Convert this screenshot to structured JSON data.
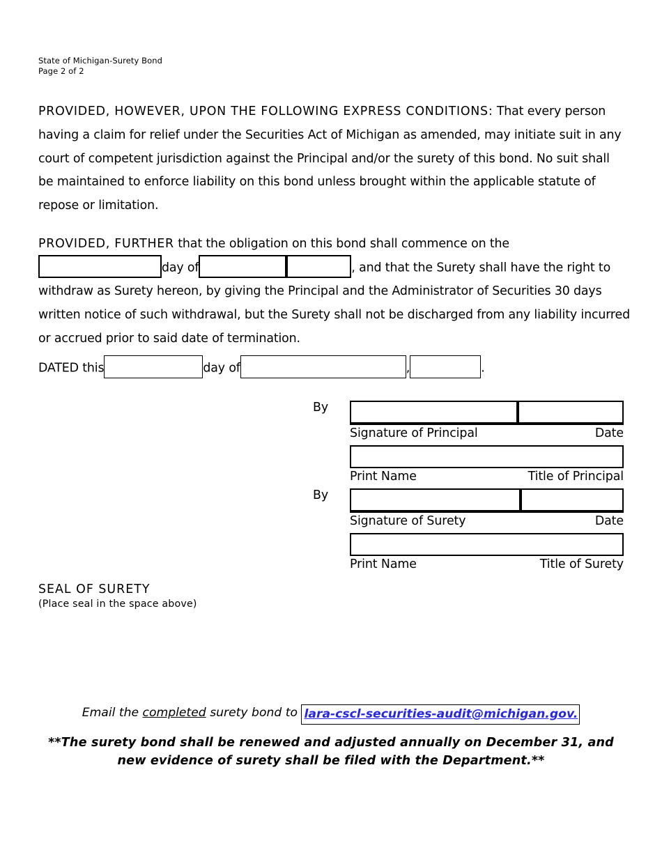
{
  "header": {
    "line1": "State of Michigan-Surety Bond",
    "line2": "Page 2 of 2"
  },
  "paragraph1": {
    "lead": "PROVIDED, HOWEVER, UPON THE FOLLOWING EXPRESS CONDITIONS:",
    "body": " That every person having a claim for relief under the Securities Act of Michigan as amended, may initiate suit in any court of competent jurisdiction against the Principal and/or the surety of this bond. No suit shall be maintained to enforce liability on this bond unless brought within the applicable statute of repose or limitation."
  },
  "paragraph2": {
    "lead": "PROVIDED, FURTHER",
    "line1_after_lead": " that the obligation on this bond shall commence on the",
    "mid_day_of": "day of",
    "after_year": ", and that the Surety shall have the right to",
    "rest": "withdraw as Surety hereon, by giving the Principal and the Administrator of Securities 30 days written notice of such withdrawal, but the Surety shall not be discharged from any liability incurred or accrued prior to said date of termination.",
    "fields": {
      "day": "",
      "month": "",
      "year": ""
    }
  },
  "dated_line": {
    "prefix": "DATED this",
    "middle": "day of",
    "comma": ",",
    "period": ".",
    "fields": {
      "day": "",
      "month": "",
      "year": ""
    }
  },
  "signatures": {
    "principal": {
      "by_label": "By",
      "signature_value": "",
      "date_value": "",
      "caption_left": "Signature of Principal",
      "caption_right": "Date",
      "print_name_value": "",
      "print_caption_left": "Print Name",
      "print_caption_right": "Title of Principal"
    },
    "surety": {
      "by_label": "By",
      "signature_value": "",
      "date_value": "",
      "caption_left": "Signature of Surety",
      "caption_right": "Date",
      "print_name_value": "",
      "print_caption_left": "Print Name",
      "print_caption_right": "Title of Surety"
    }
  },
  "seal": {
    "title": "SEAL OF SURETY",
    "subtitle": "(Place seal in the space above)"
  },
  "footer": {
    "email_prefix": "Email the ",
    "email_underlined_word": "completed",
    "email_middle": " surety bond to ",
    "email_address": "lara-cscl-securities-audit@michigan.gov.",
    "note": "**The surety bond shall be renewed and adjusted annually on December 31, and new evidence of surety shall be filed with the Department.**"
  },
  "colors": {
    "link": "#2727e0",
    "text": "#000000",
    "background": "#ffffff"
  }
}
